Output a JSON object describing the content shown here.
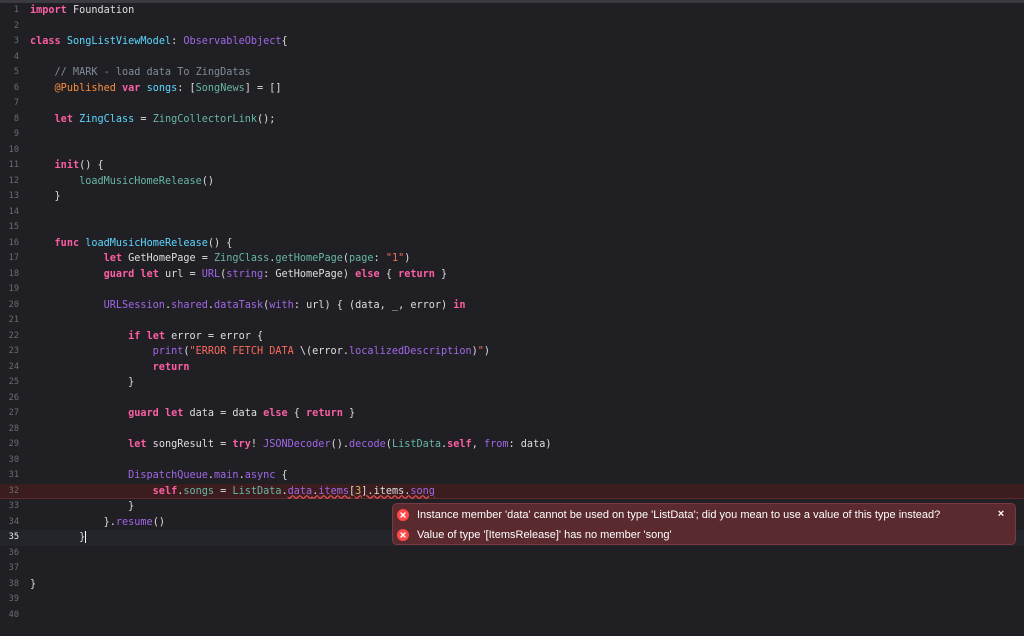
{
  "editor": {
    "lines": [
      {
        "n": "1",
        "tokens": [
          {
            "t": "import",
            "c": "kw"
          },
          {
            "t": " Foundation",
            "c": "pl"
          }
        ]
      },
      {
        "n": "2",
        "tokens": []
      },
      {
        "n": "3",
        "tokens": [
          {
            "t": "class",
            "c": "kw"
          },
          {
            "t": " ",
            "c": "pl"
          },
          {
            "t": "SongListViewModel",
            "c": "ty"
          },
          {
            "t": ": ",
            "c": "pl"
          },
          {
            "t": "ObservableObject",
            "c": "fn"
          },
          {
            "t": "{",
            "c": "pl"
          }
        ]
      },
      {
        "n": "4",
        "tokens": []
      },
      {
        "n": "5",
        "tokens": [
          {
            "t": "    // MARK - load data To ZingDatas",
            "c": "cm"
          }
        ]
      },
      {
        "n": "6",
        "tokens": [
          {
            "t": "    ",
            "c": "pl"
          },
          {
            "t": "@Published",
            "c": "at"
          },
          {
            "t": " ",
            "c": "pl"
          },
          {
            "t": "var",
            "c": "kw"
          },
          {
            "t": " ",
            "c": "pl"
          },
          {
            "t": "songs",
            "c": "ty"
          },
          {
            "t": ": [",
            "c": "pl"
          },
          {
            "t": "SongNews",
            "c": "id"
          },
          {
            "t": "] = []",
            "c": "pl"
          }
        ]
      },
      {
        "n": "7",
        "tokens": []
      },
      {
        "n": "8",
        "tokens": [
          {
            "t": "    ",
            "c": "pl"
          },
          {
            "t": "let",
            "c": "kw"
          },
          {
            "t": " ",
            "c": "pl"
          },
          {
            "t": "ZingClass",
            "c": "ty"
          },
          {
            "t": " = ",
            "c": "pl"
          },
          {
            "t": "ZingCollectorLink",
            "c": "id"
          },
          {
            "t": "();",
            "c": "pl"
          }
        ]
      },
      {
        "n": "9",
        "tokens": []
      },
      {
        "n": "10",
        "tokens": []
      },
      {
        "n": "11",
        "tokens": [
          {
            "t": "    ",
            "c": "pl"
          },
          {
            "t": "init",
            "c": "kw"
          },
          {
            "t": "() {",
            "c": "pl"
          }
        ]
      },
      {
        "n": "12",
        "tokens": [
          {
            "t": "        ",
            "c": "pl"
          },
          {
            "t": "loadMusicHomeRelease",
            "c": "id"
          },
          {
            "t": "()",
            "c": "pl"
          }
        ]
      },
      {
        "n": "13",
        "tokens": [
          {
            "t": "    }",
            "c": "pl"
          }
        ]
      },
      {
        "n": "14",
        "tokens": []
      },
      {
        "n": "15",
        "tokens": []
      },
      {
        "n": "16",
        "tokens": [
          {
            "t": "    ",
            "c": "pl"
          },
          {
            "t": "func",
            "c": "kw"
          },
          {
            "t": " ",
            "c": "pl"
          },
          {
            "t": "loadMusicHomeRelease",
            "c": "ty"
          },
          {
            "t": "() {",
            "c": "pl"
          }
        ]
      },
      {
        "n": "17",
        "tokens": [
          {
            "t": "            ",
            "c": "pl"
          },
          {
            "t": "let",
            "c": "kw"
          },
          {
            "t": " GetHomePage = ",
            "c": "pl"
          },
          {
            "t": "ZingClass",
            "c": "id"
          },
          {
            "t": ".",
            "c": "pl"
          },
          {
            "t": "getHomePage",
            "c": "id"
          },
          {
            "t": "(",
            "c": "pl"
          },
          {
            "t": "page",
            "c": "id"
          },
          {
            "t": ": ",
            "c": "pl"
          },
          {
            "t": "\"1\"",
            "c": "st"
          },
          {
            "t": ")",
            "c": "pl"
          }
        ]
      },
      {
        "n": "18",
        "tokens": [
          {
            "t": "            ",
            "c": "pl"
          },
          {
            "t": "guard",
            "c": "kw"
          },
          {
            "t": " ",
            "c": "pl"
          },
          {
            "t": "let",
            "c": "kw"
          },
          {
            "t": " url = ",
            "c": "pl"
          },
          {
            "t": "URL",
            "c": "fn"
          },
          {
            "t": "(",
            "c": "pl"
          },
          {
            "t": "string",
            "c": "fn"
          },
          {
            "t": ": GetHomePage) ",
            "c": "pl"
          },
          {
            "t": "else",
            "c": "kw"
          },
          {
            "t": " { ",
            "c": "pl"
          },
          {
            "t": "return",
            "c": "kw"
          },
          {
            "t": " }",
            "c": "pl"
          }
        ]
      },
      {
        "n": "19",
        "tokens": []
      },
      {
        "n": "20",
        "tokens": [
          {
            "t": "            ",
            "c": "pl"
          },
          {
            "t": "URLSession",
            "c": "fn"
          },
          {
            "t": ".",
            "c": "pl"
          },
          {
            "t": "shared",
            "c": "fn"
          },
          {
            "t": ".",
            "c": "pl"
          },
          {
            "t": "dataTask",
            "c": "fn"
          },
          {
            "t": "(",
            "c": "pl"
          },
          {
            "t": "with",
            "c": "fn"
          },
          {
            "t": ": url) { (data, _, error) ",
            "c": "pl"
          },
          {
            "t": "in",
            "c": "kw"
          }
        ]
      },
      {
        "n": "21",
        "tokens": []
      },
      {
        "n": "22",
        "tokens": [
          {
            "t": "                ",
            "c": "pl"
          },
          {
            "t": "if",
            "c": "kw"
          },
          {
            "t": " ",
            "c": "pl"
          },
          {
            "t": "let",
            "c": "kw"
          },
          {
            "t": " error = error {",
            "c": "pl"
          }
        ]
      },
      {
        "n": "23",
        "tokens": [
          {
            "t": "                    ",
            "c": "pl"
          },
          {
            "t": "print",
            "c": "fn"
          },
          {
            "t": "(",
            "c": "pl"
          },
          {
            "t": "\"ERROR FETCH DATA ",
            "c": "st"
          },
          {
            "t": "\\(error.",
            "c": "pl"
          },
          {
            "t": "localizedDescription",
            "c": "fn"
          },
          {
            "t": ")",
            "c": "pl"
          },
          {
            "t": "\"",
            "c": "st"
          },
          {
            "t": ")",
            "c": "pl"
          }
        ]
      },
      {
        "n": "24",
        "tokens": [
          {
            "t": "                    ",
            "c": "pl"
          },
          {
            "t": "return",
            "c": "kw"
          }
        ]
      },
      {
        "n": "25",
        "tokens": [
          {
            "t": "                }",
            "c": "pl"
          }
        ]
      },
      {
        "n": "26",
        "tokens": []
      },
      {
        "n": "27",
        "tokens": [
          {
            "t": "                ",
            "c": "pl"
          },
          {
            "t": "guard",
            "c": "kw"
          },
          {
            "t": " ",
            "c": "pl"
          },
          {
            "t": "let",
            "c": "kw"
          },
          {
            "t": " data = data ",
            "c": "pl"
          },
          {
            "t": "else",
            "c": "kw"
          },
          {
            "t": " { ",
            "c": "pl"
          },
          {
            "t": "return",
            "c": "kw"
          },
          {
            "t": " }",
            "c": "pl"
          }
        ]
      },
      {
        "n": "28",
        "tokens": []
      },
      {
        "n": "29",
        "tokens": [
          {
            "t": "                ",
            "c": "pl"
          },
          {
            "t": "let",
            "c": "kw"
          },
          {
            "t": " songResult = ",
            "c": "pl"
          },
          {
            "t": "try",
            "c": "kw"
          },
          {
            "t": "! ",
            "c": "pl"
          },
          {
            "t": "JSONDecoder",
            "c": "fn"
          },
          {
            "t": "().",
            "c": "pl"
          },
          {
            "t": "decode",
            "c": "fn"
          },
          {
            "t": "(",
            "c": "pl"
          },
          {
            "t": "ListData",
            "c": "id"
          },
          {
            "t": ".",
            "c": "pl"
          },
          {
            "t": "self",
            "c": "kw"
          },
          {
            "t": ", ",
            "c": "pl"
          },
          {
            "t": "from",
            "c": "fn"
          },
          {
            "t": ": data)",
            "c": "pl"
          }
        ]
      },
      {
        "n": "30",
        "tokens": []
      },
      {
        "n": "31",
        "tokens": [
          {
            "t": "                ",
            "c": "pl"
          },
          {
            "t": "DispatchQueue",
            "c": "fn"
          },
          {
            "t": ".",
            "c": "pl"
          },
          {
            "t": "main",
            "c": "fn"
          },
          {
            "t": ".",
            "c": "pl"
          },
          {
            "t": "async",
            "c": "fn"
          },
          {
            "t": " {",
            "c": "pl"
          }
        ]
      },
      {
        "n": "32",
        "err": true,
        "tokens": [
          {
            "t": "                    ",
            "c": "pl"
          },
          {
            "t": "self",
            "c": "kw"
          },
          {
            "t": ".",
            "c": "pl"
          },
          {
            "t": "songs",
            "c": "id"
          },
          {
            "t": " = ",
            "c": "pl"
          },
          {
            "t": "ListData",
            "c": "id"
          },
          {
            "t": ".",
            "c": "pl"
          },
          {
            "t": "data",
            "c": "fn",
            "u": true
          },
          {
            "t": ".",
            "c": "pl",
            "u": true
          },
          {
            "t": "items",
            "c": "fn",
            "u": true
          },
          {
            "t": "[",
            "c": "pl",
            "u": true
          },
          {
            "t": "3",
            "c": "nu",
            "u": true
          },
          {
            "t": "].items.",
            "c": "pl",
            "u": true
          },
          {
            "t": "song",
            "c": "fn",
            "u": true
          }
        ]
      },
      {
        "n": "33",
        "tokens": [
          {
            "t": "                }",
            "c": "pl"
          }
        ]
      },
      {
        "n": "34",
        "tokens": [
          {
            "t": "            }.",
            "c": "pl"
          },
          {
            "t": "resume",
            "c": "fn"
          },
          {
            "t": "()",
            "c": "pl"
          }
        ]
      },
      {
        "n": "35",
        "cur": true,
        "tokens": [
          {
            "t": "        }",
            "c": "pl"
          }
        ]
      },
      {
        "n": "36",
        "tokens": []
      },
      {
        "n": "37",
        "tokens": []
      },
      {
        "n": "38",
        "tokens": [
          {
            "t": "}",
            "c": "pl"
          }
        ]
      },
      {
        "n": "39",
        "tokens": []
      },
      {
        "n": "40",
        "tokens": []
      }
    ]
  },
  "errors": {
    "items": [
      {
        "text": "Instance member 'data' cannot be used on type 'ListData'; did you mean to use a value of this type instead?"
      },
      {
        "text": "Value of type '[ItemsRelease]' has no member 'song'"
      }
    ],
    "close_glyph": "×",
    "icon": "error-circle-icon",
    "color": "#ff4a4a"
  }
}
